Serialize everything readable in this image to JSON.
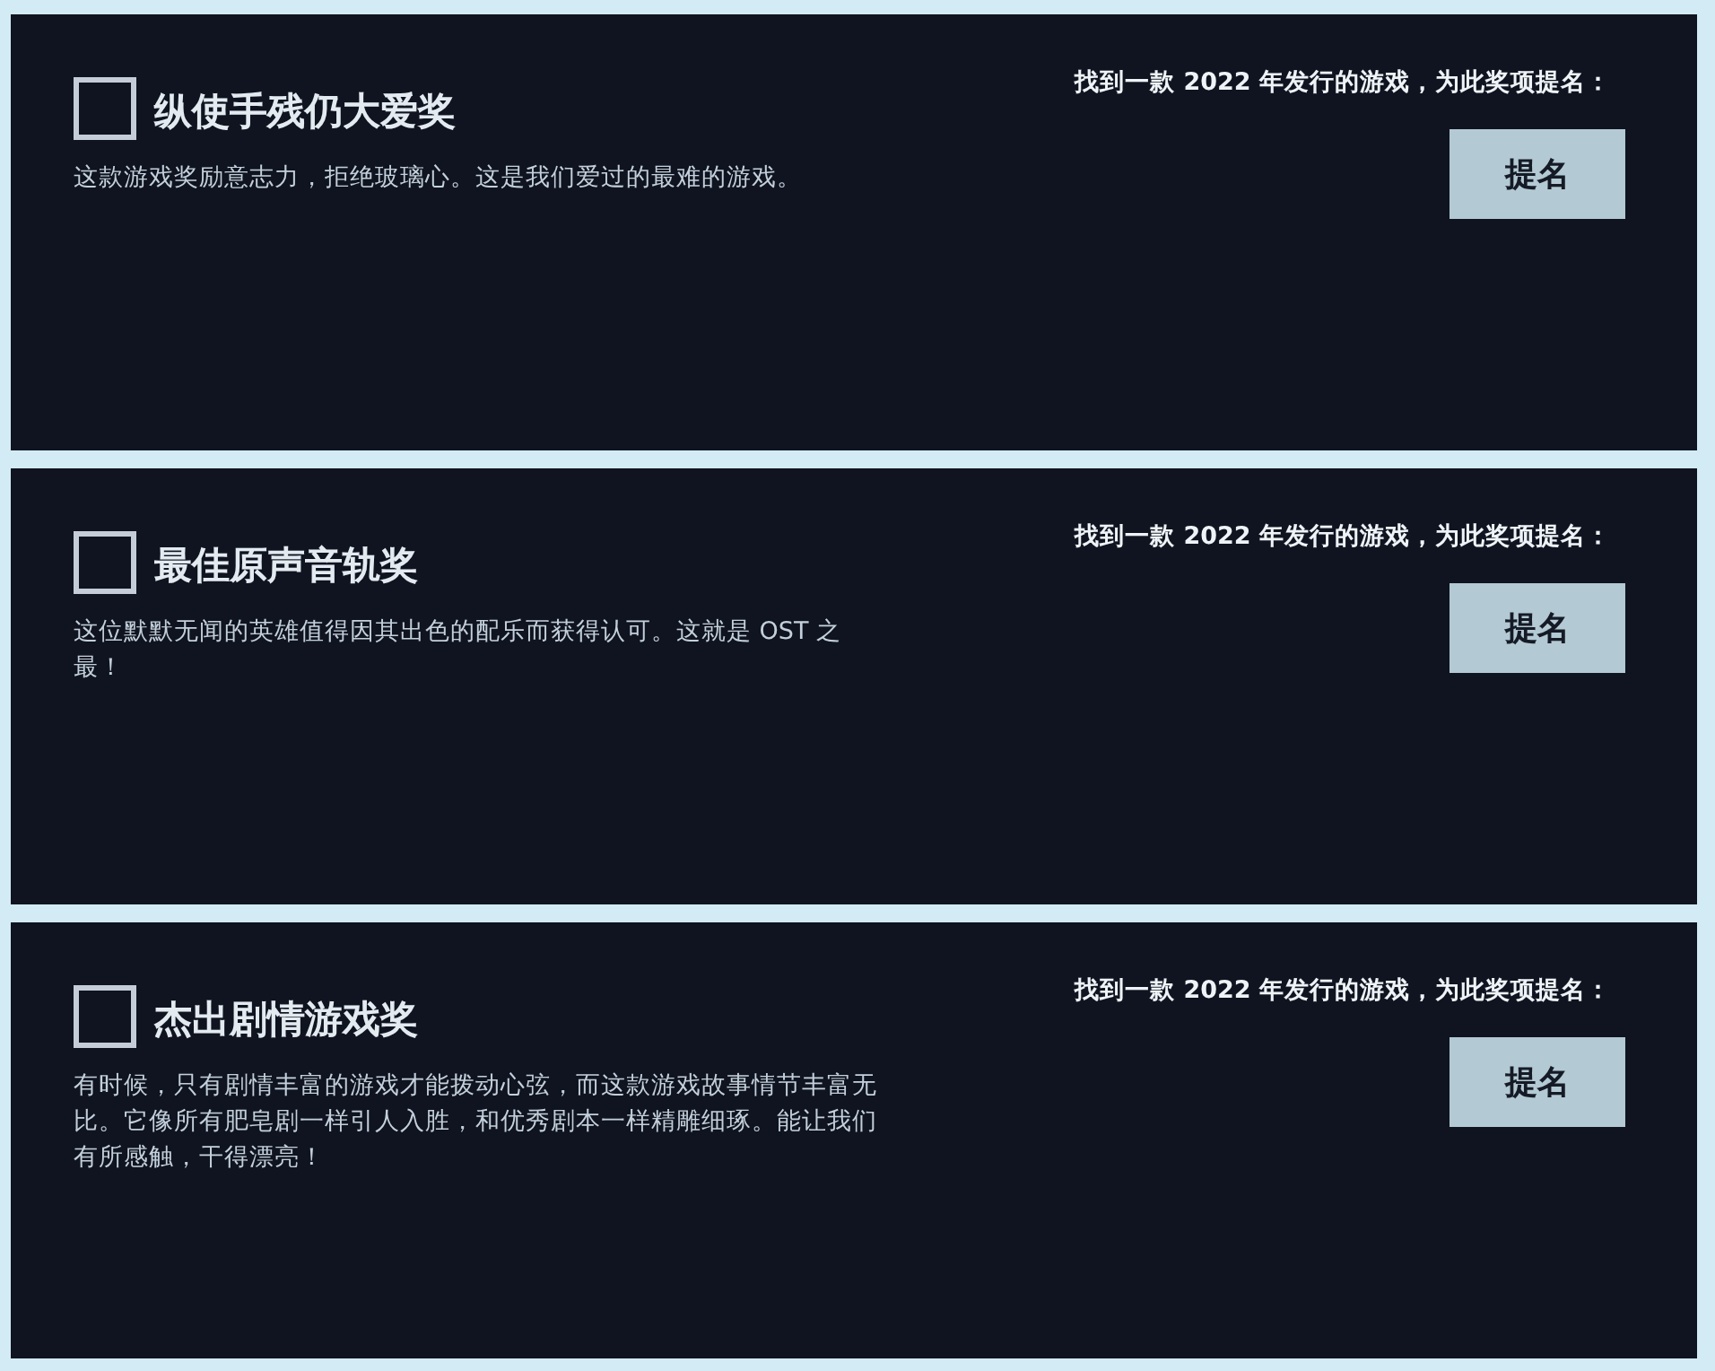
{
  "awards": [
    {
      "title": "纵使手残仍大爱奖",
      "checked": false,
      "description": "这款游戏奖励意志力，拒绝玻璃心。这是我们爱过的最难的游戏。",
      "prompt": "找到一款 2022 年发行的游戏，为此奖项提名：",
      "button": "提名"
    },
    {
      "title": "最佳原声音轨奖",
      "checked": false,
      "description": "这位默默无闻的英雄值得因其出色的配乐而获得认可。这就是 OST 之最！",
      "prompt": "找到一款 2022 年发行的游戏，为此奖项提名：",
      "button": "提名"
    },
    {
      "title": "杰出剧情游戏奖",
      "checked": false,
      "description": "有时候，只有剧情丰富的游戏才能拨动心弦，而这款游戏故事情节丰富无比。它像所有肥皂剧一样引人入胜，和优秀剧本一样精雕细琢。能让我们有所感触，干得漂亮！",
      "prompt": "找到一款 2022 年发行的游戏，为此奖项提名：",
      "button": "提名"
    }
  ]
}
